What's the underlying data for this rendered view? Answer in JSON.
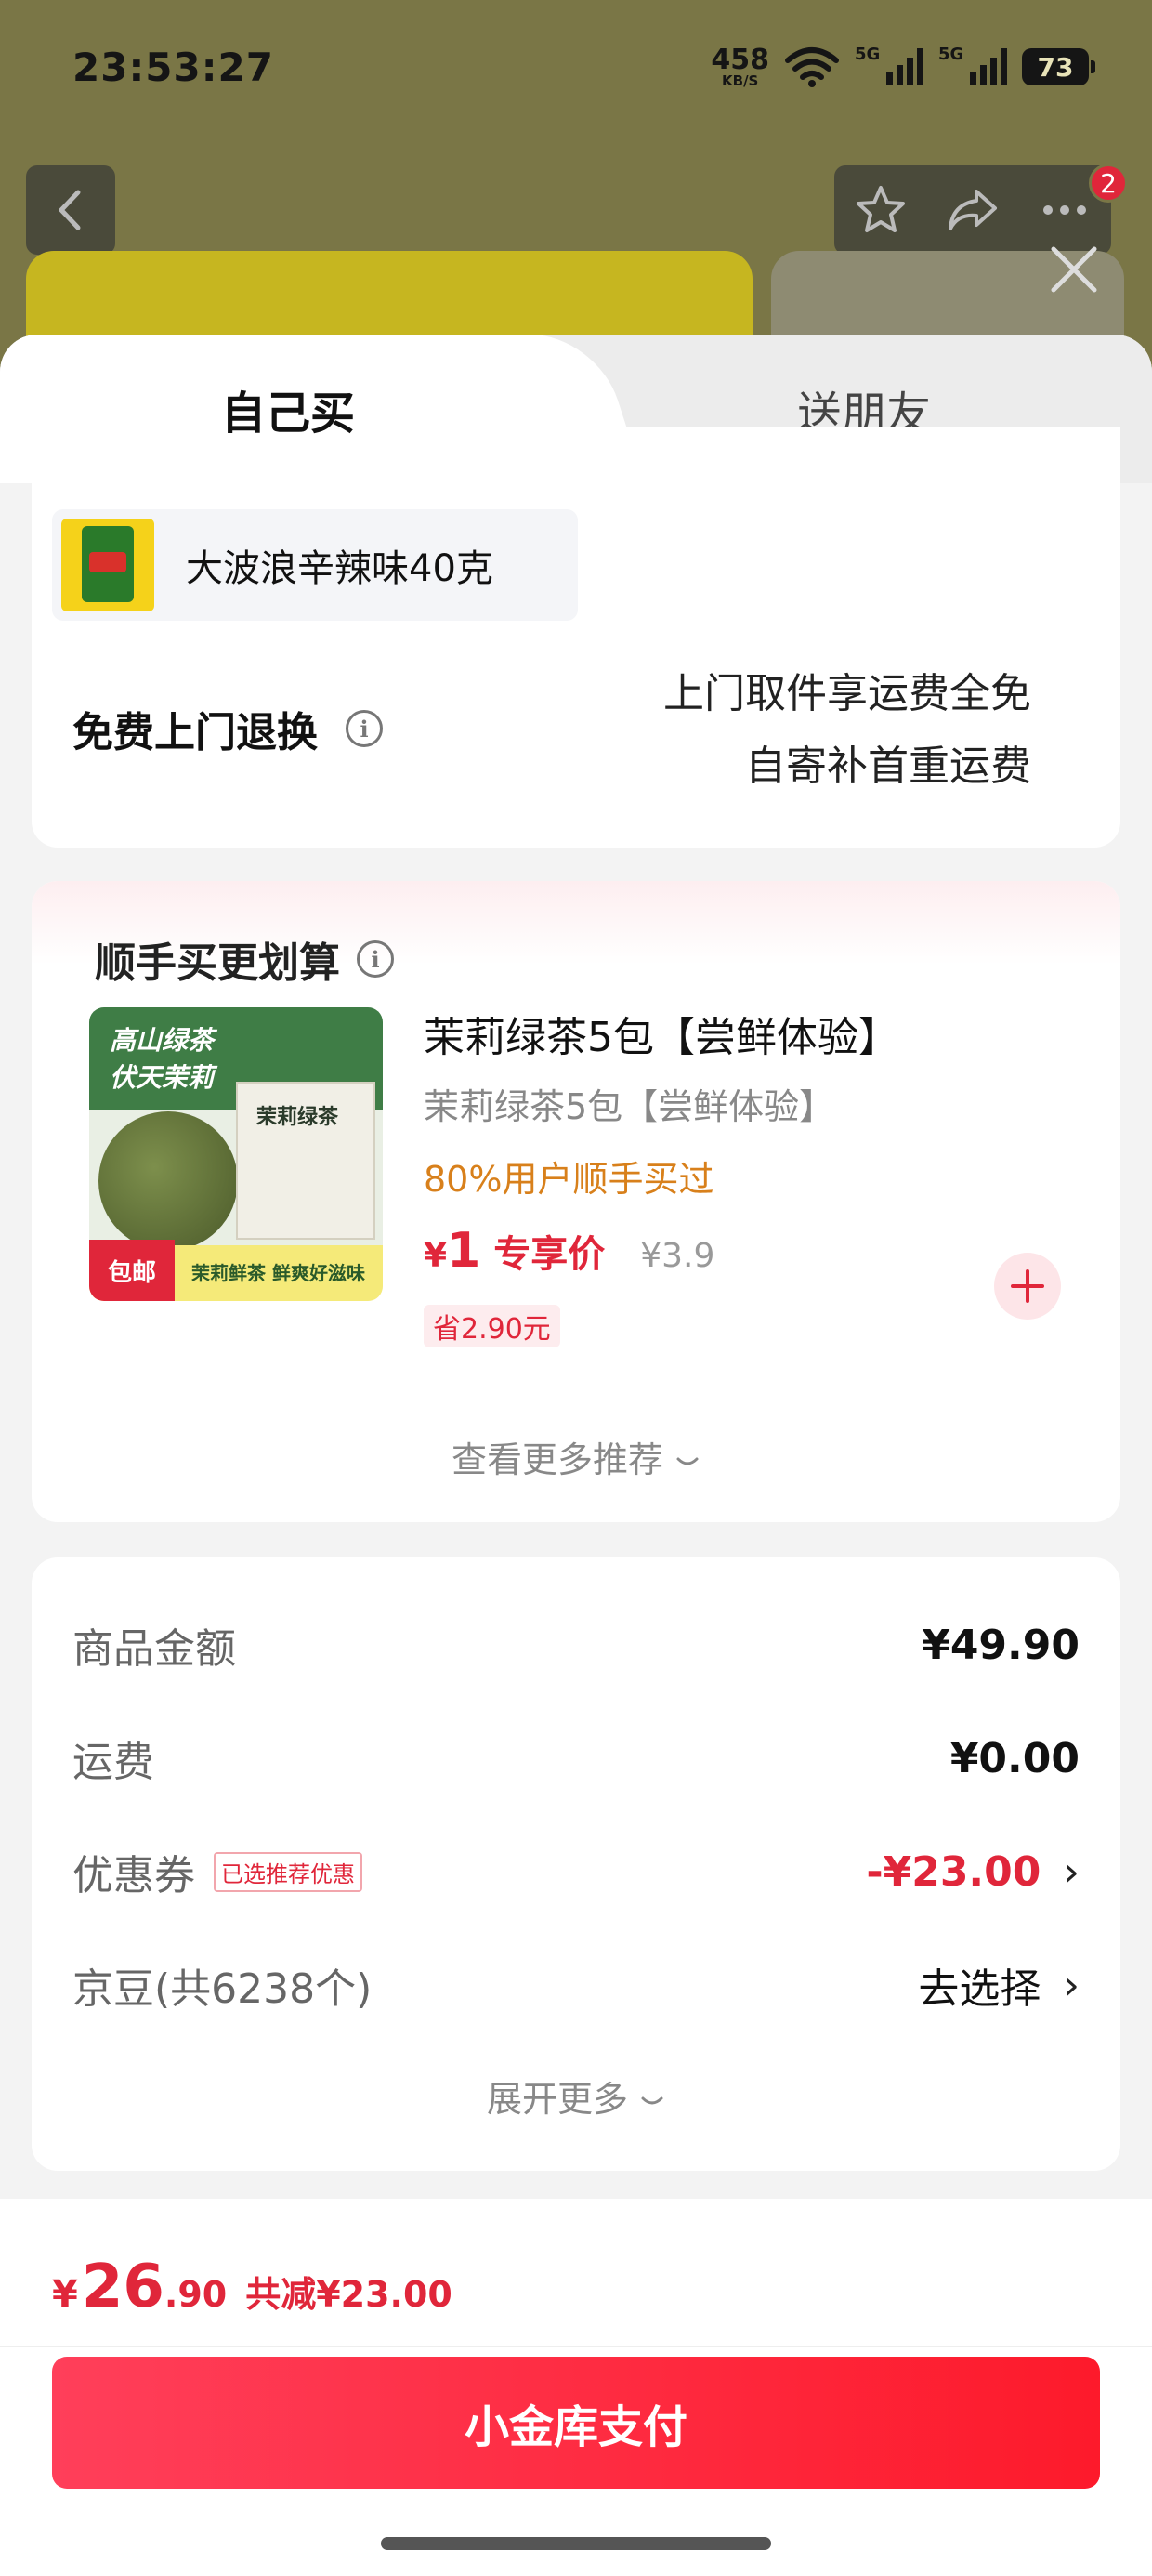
{
  "status_bar": {
    "time": "23:53:27",
    "net_speed": "458",
    "net_unit": "KB/S",
    "signal1": "5G",
    "signal2": "5G",
    "battery": "73"
  },
  "header": {
    "cart_badge": "2"
  },
  "tabs": {
    "self": "自己买",
    "gift": "送朋友"
  },
  "sku": {
    "label": "大波浪辛辣味40克"
  },
  "return_policy": {
    "title": "免费上门退换",
    "line1": "上门取件享运费全免",
    "line2": "自寄补首重运费"
  },
  "recommend": {
    "title": "顺手买更划算",
    "product_name": "茉莉绿茶5包【尝鲜体验】",
    "product_sub": "茉莉绿茶5包【尝鲜体验】",
    "bought": "80%用户顺手买过",
    "currency": "¥",
    "price": "1",
    "price_label": "专享价",
    "original_price": "¥3.9",
    "save": "省2.90元",
    "more": "查看更多推荐",
    "img_header": "高山绿茶\n伏天茉莉",
    "img_pack": "茉莉绿茶",
    "img_foot": "茉莉鲜茶 鲜爽好滋味",
    "img_mail": "包邮"
  },
  "summary": {
    "goods_label": "商品金额",
    "goods_value": "¥49.90",
    "shipping_label": "运费",
    "shipping_value": "¥0.00",
    "coupon_label": "优惠券",
    "coupon_tag": "已选推荐优惠",
    "coupon_value": "-¥23.00",
    "jd_beans_label": "京豆(共6238个)",
    "jd_beans_value": "去选择",
    "expand": "展开更多"
  },
  "footer": {
    "currency": "¥",
    "total_int": "26",
    "total_dec": ".90",
    "discount": "共减¥23.00",
    "pay_button": "小金库支付"
  },
  "colors": {
    "accent": "#e0263a",
    "orange": "#d8801b"
  }
}
